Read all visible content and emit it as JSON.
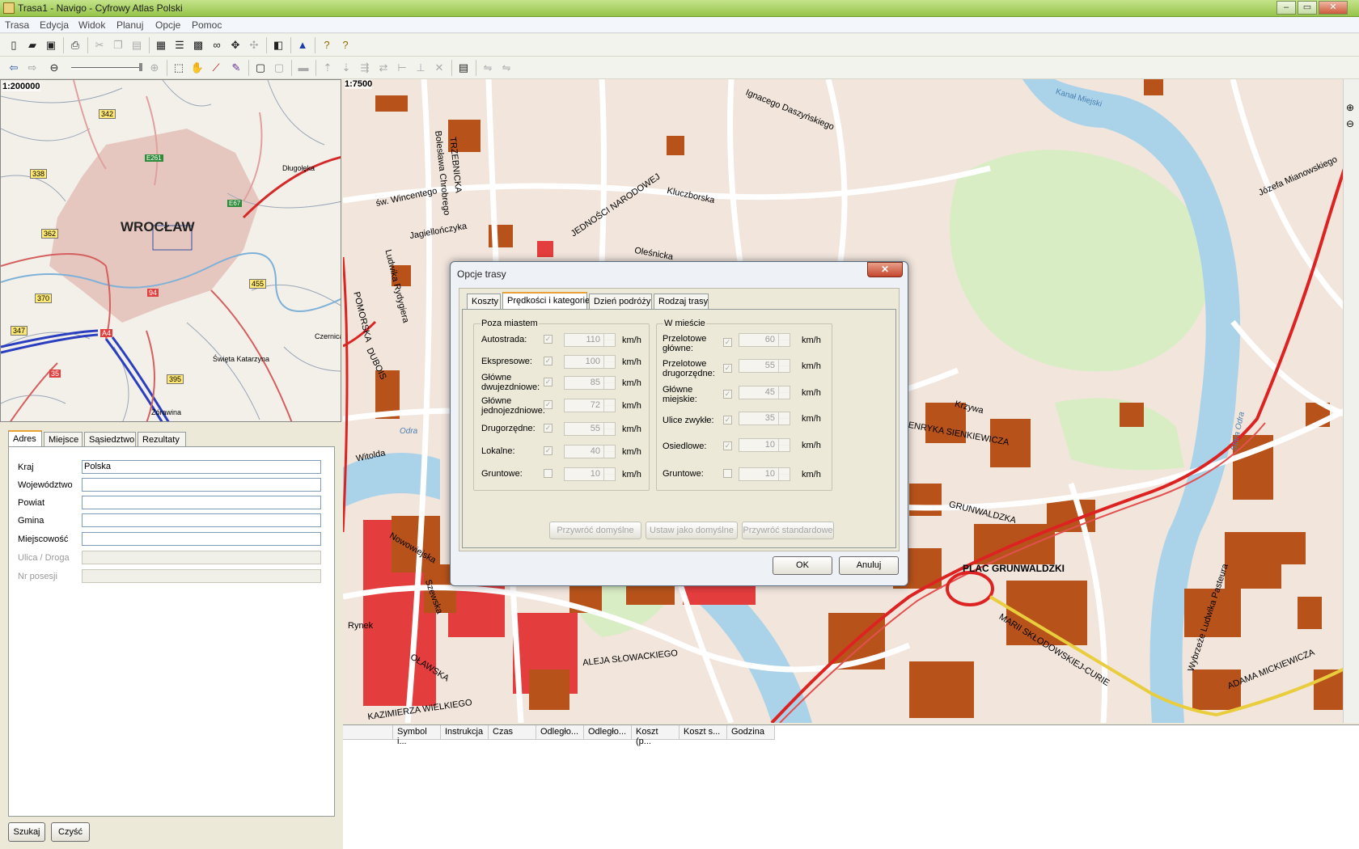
{
  "window": {
    "title": "Trasa1 - Navigo - Cyfrowy Atlas Polski",
    "controls": {
      "minimize": "‒",
      "maximize": "▭",
      "close": "✕"
    }
  },
  "menu": [
    "Trasa",
    "Edycja",
    "Widok",
    "Planuj",
    "Opcje",
    "Pomoc"
  ],
  "minimap": {
    "scale": "1:200000",
    "city": "WROCŁAW",
    "places": [
      "Długołęka",
      "Czernica",
      "Święta Katarzyna",
      "Żórawina"
    ],
    "roads": [
      "342",
      "338",
      "362",
      "370",
      "347",
      "35",
      "A4",
      "94",
      "395",
      "455",
      "E261",
      "E67"
    ]
  },
  "map": {
    "scale": "1:7500",
    "streets": [
      "Ignacego Daszyńskiego",
      "Kanał Miejski",
      "TRZEBNICKA",
      "Bolesława Chrobrego",
      "św. Wincentego",
      "Jagiellończyka",
      "JEDNOŚCI NARODOWEJ",
      "Kluczborska",
      "Oleśnicka",
      "Ludwika Rydygiera",
      "POMORSKA",
      "DUBOIS",
      "Witolda",
      "GRUNWALDZKA",
      "PLAC GRUNWALDZKI",
      "HENRYKA SIENKIEWICZA",
      "ALEJA SŁOWACKIEGO",
      "OŁAWSKA",
      "KAZIMIERZA WIELKIEGO",
      "ADAMA MICKIEWICZA",
      "MARII SKŁODOWSKIEJ-CURIE",
      "Rynek",
      "Odra",
      "Stara Odra",
      "Józefa Mianowskiego",
      "Plac Grunwaldzki",
      "Wybrzeże Ludwika Pasteura",
      "Szewska",
      "Krzywa",
      "Nowowiejska"
    ]
  },
  "left_panel": {
    "tabs": [
      "Adres",
      "Miejsce",
      "Sąsiedztwo",
      "Rezultaty"
    ],
    "fields": [
      {
        "label": "Kraj",
        "value": "Polska",
        "enabled": true
      },
      {
        "label": "Województwo",
        "value": "",
        "enabled": true
      },
      {
        "label": "Powiat",
        "value": "",
        "enabled": true
      },
      {
        "label": "Gmina",
        "value": "",
        "enabled": true
      },
      {
        "label": "Miejscowość",
        "value": "",
        "enabled": true
      },
      {
        "label": "Ulica / Droga",
        "value": "",
        "enabled": false
      },
      {
        "label": "Nr posesji",
        "value": "",
        "enabled": false
      }
    ],
    "search_button": "Szukaj",
    "clear_button": "Czyść"
  },
  "results_grid": {
    "columns": [
      "",
      "Symbol i...",
      "Instrukcja",
      "Czas",
      "Odległo...",
      "Odległo...",
      "Koszt (p...",
      "Koszt s...",
      "Godzina"
    ]
  },
  "dialog": {
    "title": "Opcje trasy",
    "tabs": [
      "Koszty",
      "Prędkości i kategorie",
      "Dzień podróży",
      "Rodzaj trasy"
    ],
    "outside_group": {
      "title": "Poza miastem",
      "rows": [
        {
          "label": "Autostrada:",
          "value": "110",
          "checked": true
        },
        {
          "label": "Ekspresowe:",
          "value": "100",
          "checked": true
        },
        {
          "label": "Główne dwujezdniowe:",
          "value": "85",
          "checked": true
        },
        {
          "label": "Główne jednojezdniowe:",
          "value": "72",
          "checked": true
        },
        {
          "label": "Drugorzędne:",
          "value": "55",
          "checked": true
        },
        {
          "label": "Lokalne:",
          "value": "40",
          "checked": true
        },
        {
          "label": "Gruntowe:",
          "value": "10",
          "checked": false
        }
      ]
    },
    "city_group": {
      "title": "W mieście",
      "rows": [
        {
          "label": "Przelotowe główne:",
          "value": "60",
          "checked": true
        },
        {
          "label": "Przelotowe drugorzędne:",
          "value": "55",
          "checked": true
        },
        {
          "label": "Główne miejskie:",
          "value": "45",
          "checked": true
        },
        {
          "label": "Ulice zwykłe:",
          "value": "35",
          "checked": true
        },
        {
          "label": "Osiedlowe:",
          "value": "10",
          "checked": true
        },
        {
          "label": "Gruntowe:",
          "value": "10",
          "checked": false
        }
      ]
    },
    "unit": "km/h",
    "buttons": [
      "Przywróć domyślne",
      "Ustaw jako domyślne",
      "Przywróć standardowe"
    ],
    "ok": "OK",
    "cancel": "Anuluj"
  }
}
